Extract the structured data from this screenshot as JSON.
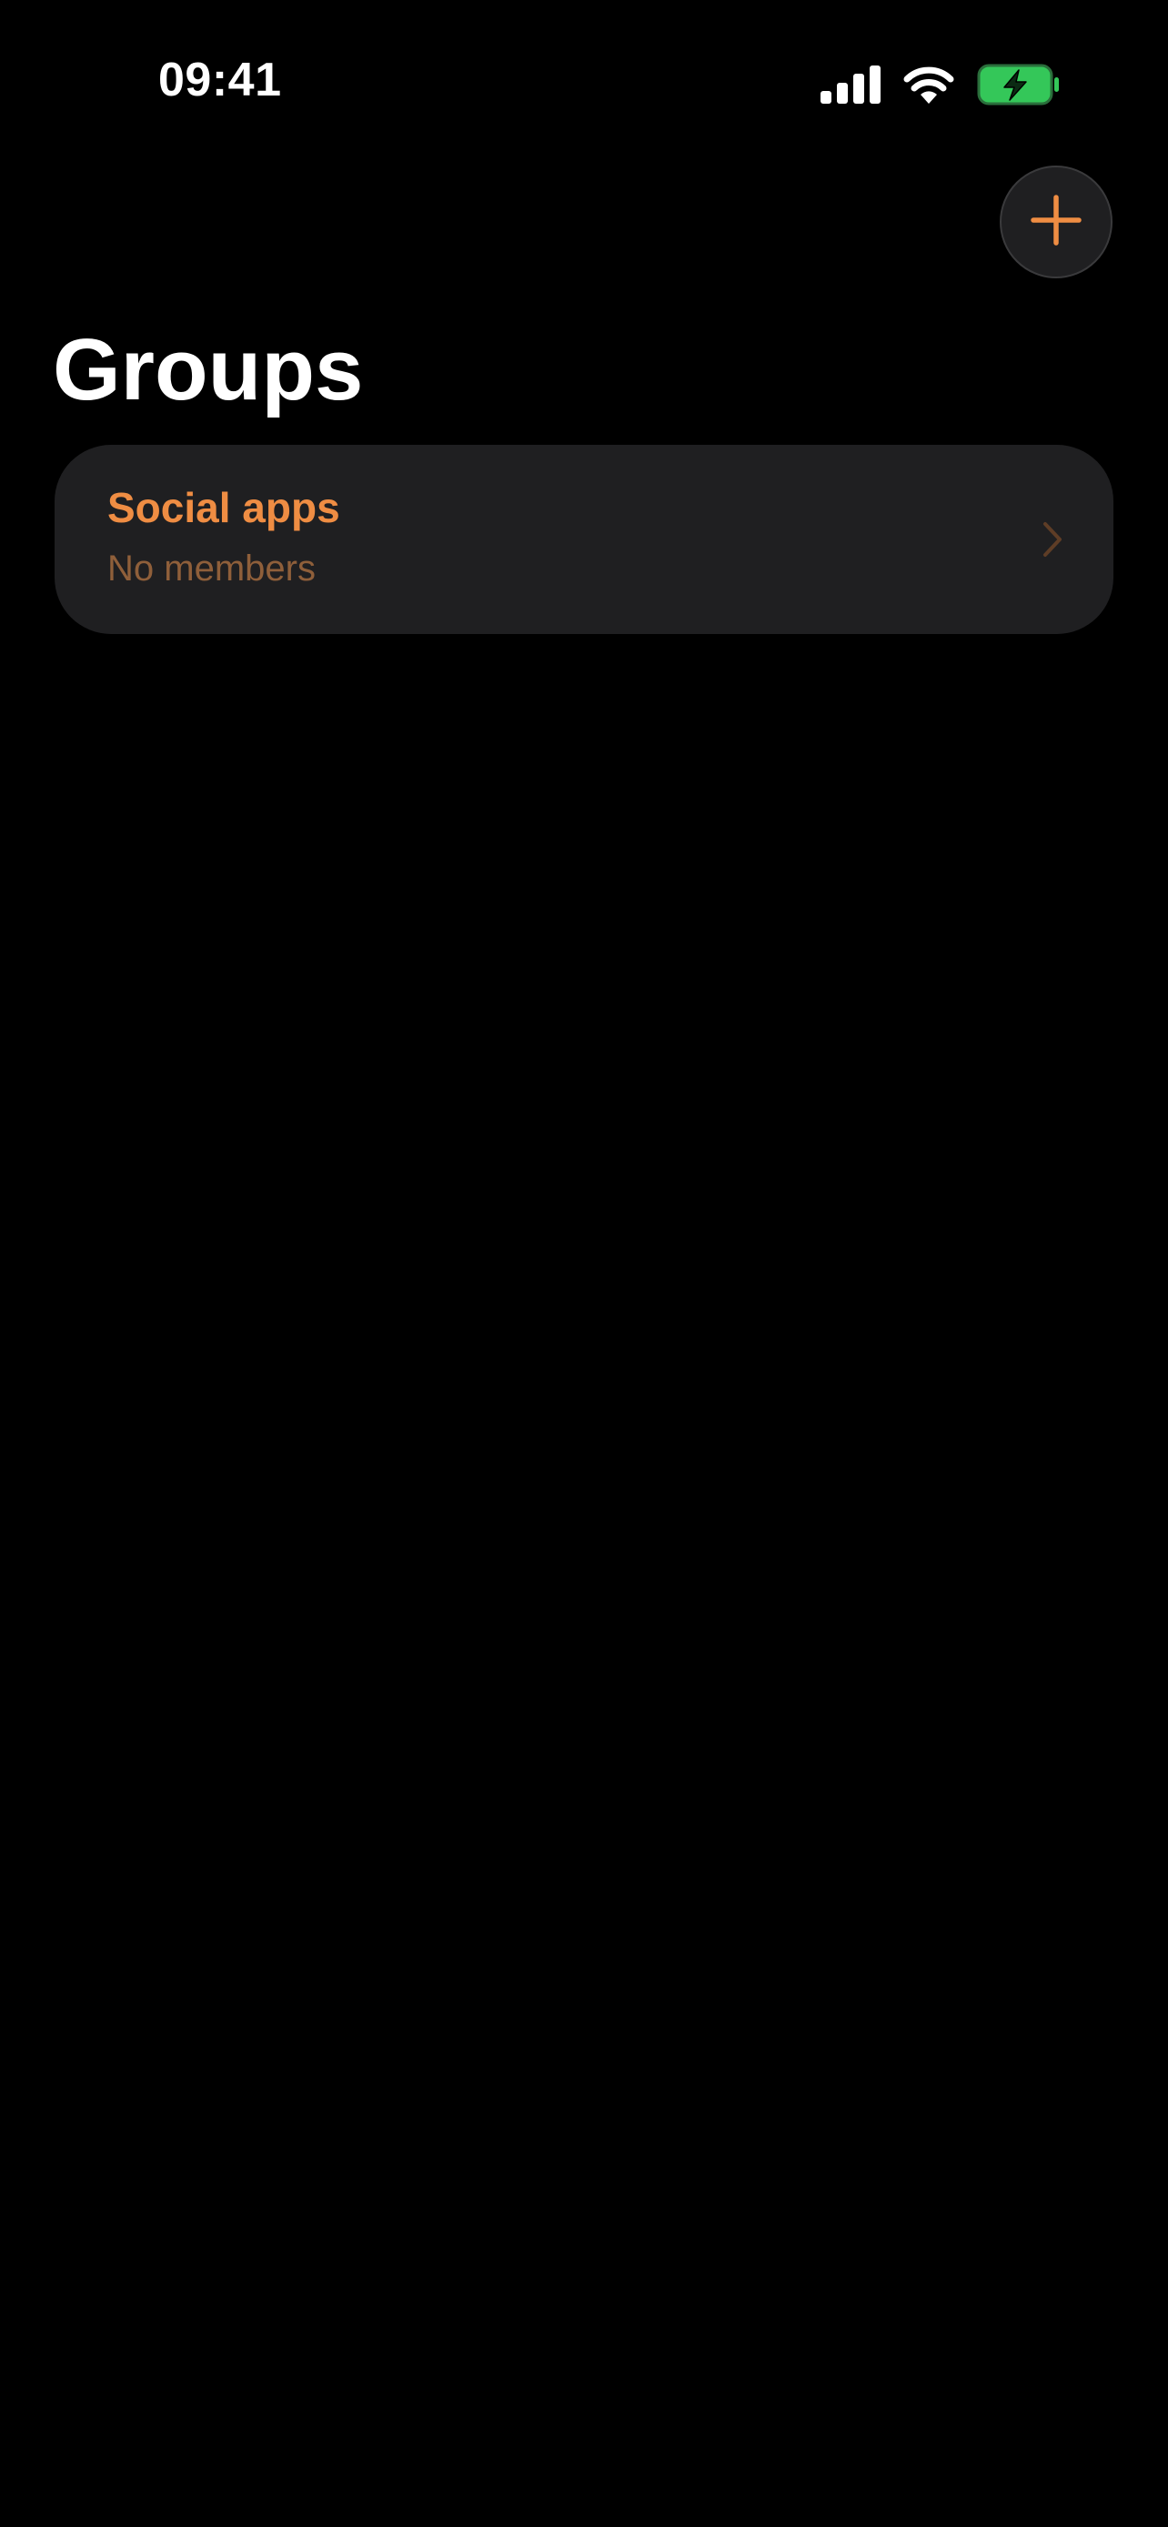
{
  "status_bar": {
    "time": "09:41",
    "icons": [
      "cellular-signal-icon",
      "wifi-icon",
      "battery-charging-icon"
    ]
  },
  "header": {
    "title": "Groups",
    "add_icon": "plus-icon"
  },
  "groups": [
    {
      "name": "Social apps",
      "subtitle": "No members",
      "chevron_icon": "chevron-right-icon"
    }
  ],
  "colors": {
    "accent": "#ef8d43",
    "subtitle": "#8f5f3a",
    "card_background": "#1f1f21",
    "background": "#000000",
    "battery_green": "#34c759"
  }
}
